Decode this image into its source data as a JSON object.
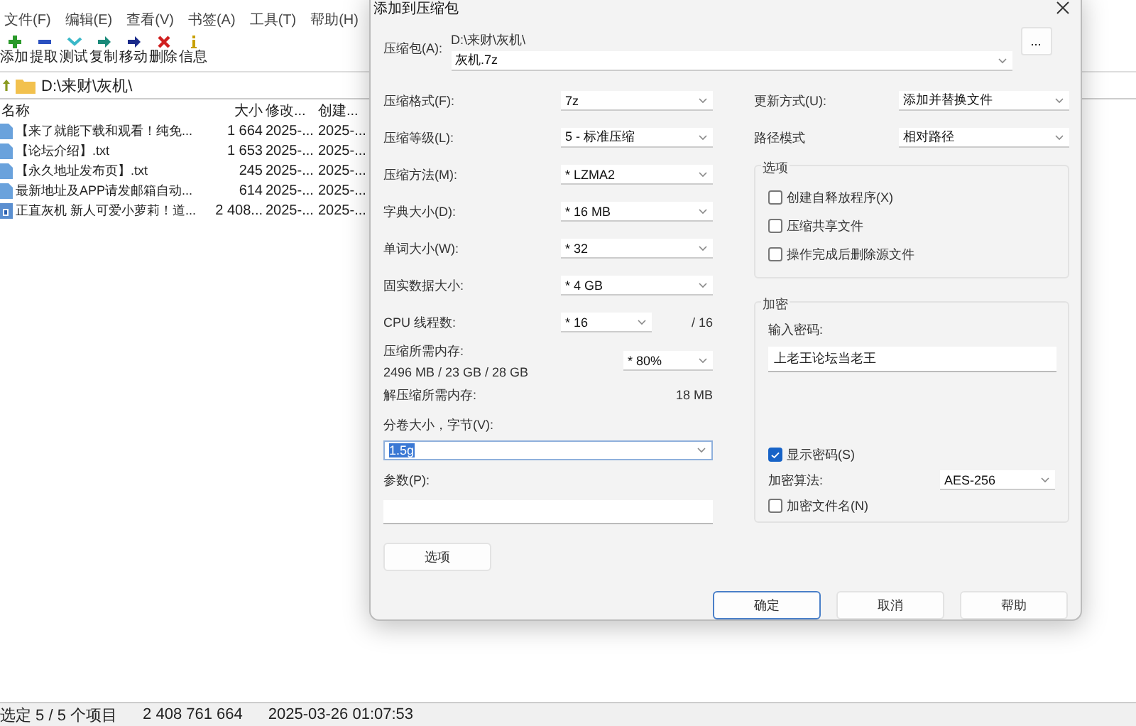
{
  "file_manager": {
    "menu": [
      "文件(F)",
      "编辑(E)",
      "查看(V)",
      "书签(A)",
      "工具(T)",
      "帮助(H)"
    ],
    "toolbar": [
      {
        "label": "添加",
        "kind": "add"
      },
      {
        "label": "提取",
        "kind": "extract"
      },
      {
        "label": "测试",
        "kind": "test"
      },
      {
        "label": "复制",
        "kind": "copy"
      },
      {
        "label": "移动",
        "kind": "move"
      },
      {
        "label": "删除",
        "kind": "delete"
      },
      {
        "label": "信息",
        "kind": "info"
      }
    ],
    "path": "D:\\来财\\灰机\\",
    "columns": [
      "名称",
      "大小",
      "修改...",
      "创建..."
    ],
    "rows": [
      {
        "name": "【来了就能下载和观看！纯免...",
        "size": "1 664",
        "modified": "2025-...",
        "created": "2025-...",
        "kind": "text"
      },
      {
        "name": "【论坛介绍】.txt",
        "size": "1 653",
        "modified": "2025-...",
        "created": "2025-...",
        "kind": "text"
      },
      {
        "name": "【永久地址发布页】.txt",
        "size": "245",
        "modified": "2025-...",
        "created": "2025-...",
        "kind": "text"
      },
      {
        "name": "最新地址及APP请发邮箱自动...",
        "size": "614",
        "modified": "2025-...",
        "created": "2025-...",
        "kind": "text"
      },
      {
        "name": "正直灰机 新人可爱小萝莉！道...",
        "size": "2 408...",
        "modified": "2025-...",
        "created": "2025-...",
        "kind": "archive"
      }
    ],
    "status_bar": [
      "选定 5 / 5 个项目",
      "2 408 761 664",
      "2025-03-26 01:07:53"
    ]
  },
  "dialog": {
    "title": "添加到压缩包",
    "archive": {
      "label": "压缩包(A):",
      "folder": "D:\\来财\\灰机\\",
      "value": "灰机.7z",
      "browse": "..."
    },
    "settings": [
      {
        "label": "压缩格式(F):",
        "value": "7z"
      },
      {
        "label": "压缩等级(L):",
        "value": "5 - 标准压缩"
      },
      {
        "label": "压缩方法(M):",
        "value": "*  LZMA2"
      },
      {
        "label": "字典大小(D):",
        "value": "*  16 MB"
      },
      {
        "label": "单词大小(W):",
        "value": "*  32"
      },
      {
        "label": "固实数据大小:",
        "value": "*  4 GB"
      }
    ],
    "cpu": {
      "label": "CPU 线程数:",
      "value": "*  16",
      "max": "/ 16"
    },
    "memory": {
      "label": "压缩所需内存:",
      "value": "2496 MB / 23 GB / 28 GB",
      "limit": "* 80%"
    },
    "decompress_memory": {
      "label": "解压缩所需内存:",
      "value": "18 MB"
    },
    "volume": {
      "label": "分卷大小，字节(V):",
      "value": "1.5g",
      "highlighted": true
    },
    "parameters": {
      "label": "参数(P):"
    },
    "options_button": "选项",
    "update": {
      "label": "更新方式(U):",
      "value": "添加并替换文件"
    },
    "path_mode": {
      "label": "路径模式",
      "value": "相对路径"
    },
    "options": {
      "title": "选项",
      "checkboxes": [
        {
          "label": "创建自释放程序(X)",
          "checked": false
        },
        {
          "label": "压缩共享文件",
          "checked": false
        },
        {
          "label": "操作完成后删除源文件",
          "checked": false
        }
      ]
    },
    "encryption": {
      "title": "加密",
      "password_label": "输入密码:",
      "password": "上老王论坛当老王",
      "show_password": {
        "label": "显示密码(S)",
        "checked": true
      },
      "method": {
        "label": "加密算法:",
        "value": "AES-256"
      },
      "encrypt_names": {
        "label": "加密文件名(N)",
        "checked": false
      }
    },
    "buttons": [
      {
        "label": "确定",
        "focused": true
      },
      {
        "label": "取消",
        "focused": false
      },
      {
        "label": "帮助",
        "focused": false
      }
    ]
  }
}
